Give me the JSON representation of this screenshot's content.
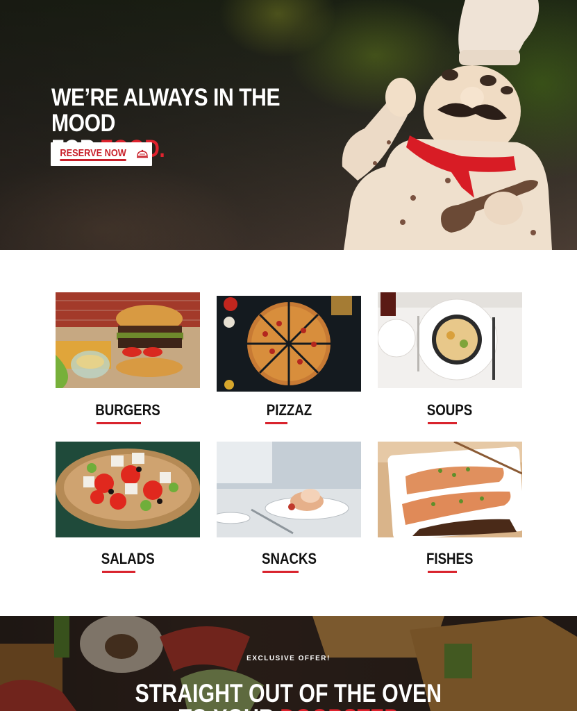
{
  "hero": {
    "title_line1": "WE’RE ALWAYS IN THE MOOD",
    "title_line2_prefix": "FOR ",
    "title_line2_accent": "FOOD.",
    "reserve_label": "RESERVE NOW",
    "accent_color": "#e0232e"
  },
  "menu": {
    "items": [
      {
        "label": "BURGERS"
      },
      {
        "label": "PIZZAZ"
      },
      {
        "label": "SOUPS"
      },
      {
        "label": "SALADS"
      },
      {
        "label": "SNACKS"
      },
      {
        "label": "FISHES"
      }
    ]
  },
  "offer": {
    "kicker": "EXCLUSIVE OFFER!",
    "title_line1": "STRAIGHT OUT OF THE OVEN",
    "title_line2_prefix": "TO YOUR ",
    "title_line2_accent": "DOORSTEP"
  }
}
